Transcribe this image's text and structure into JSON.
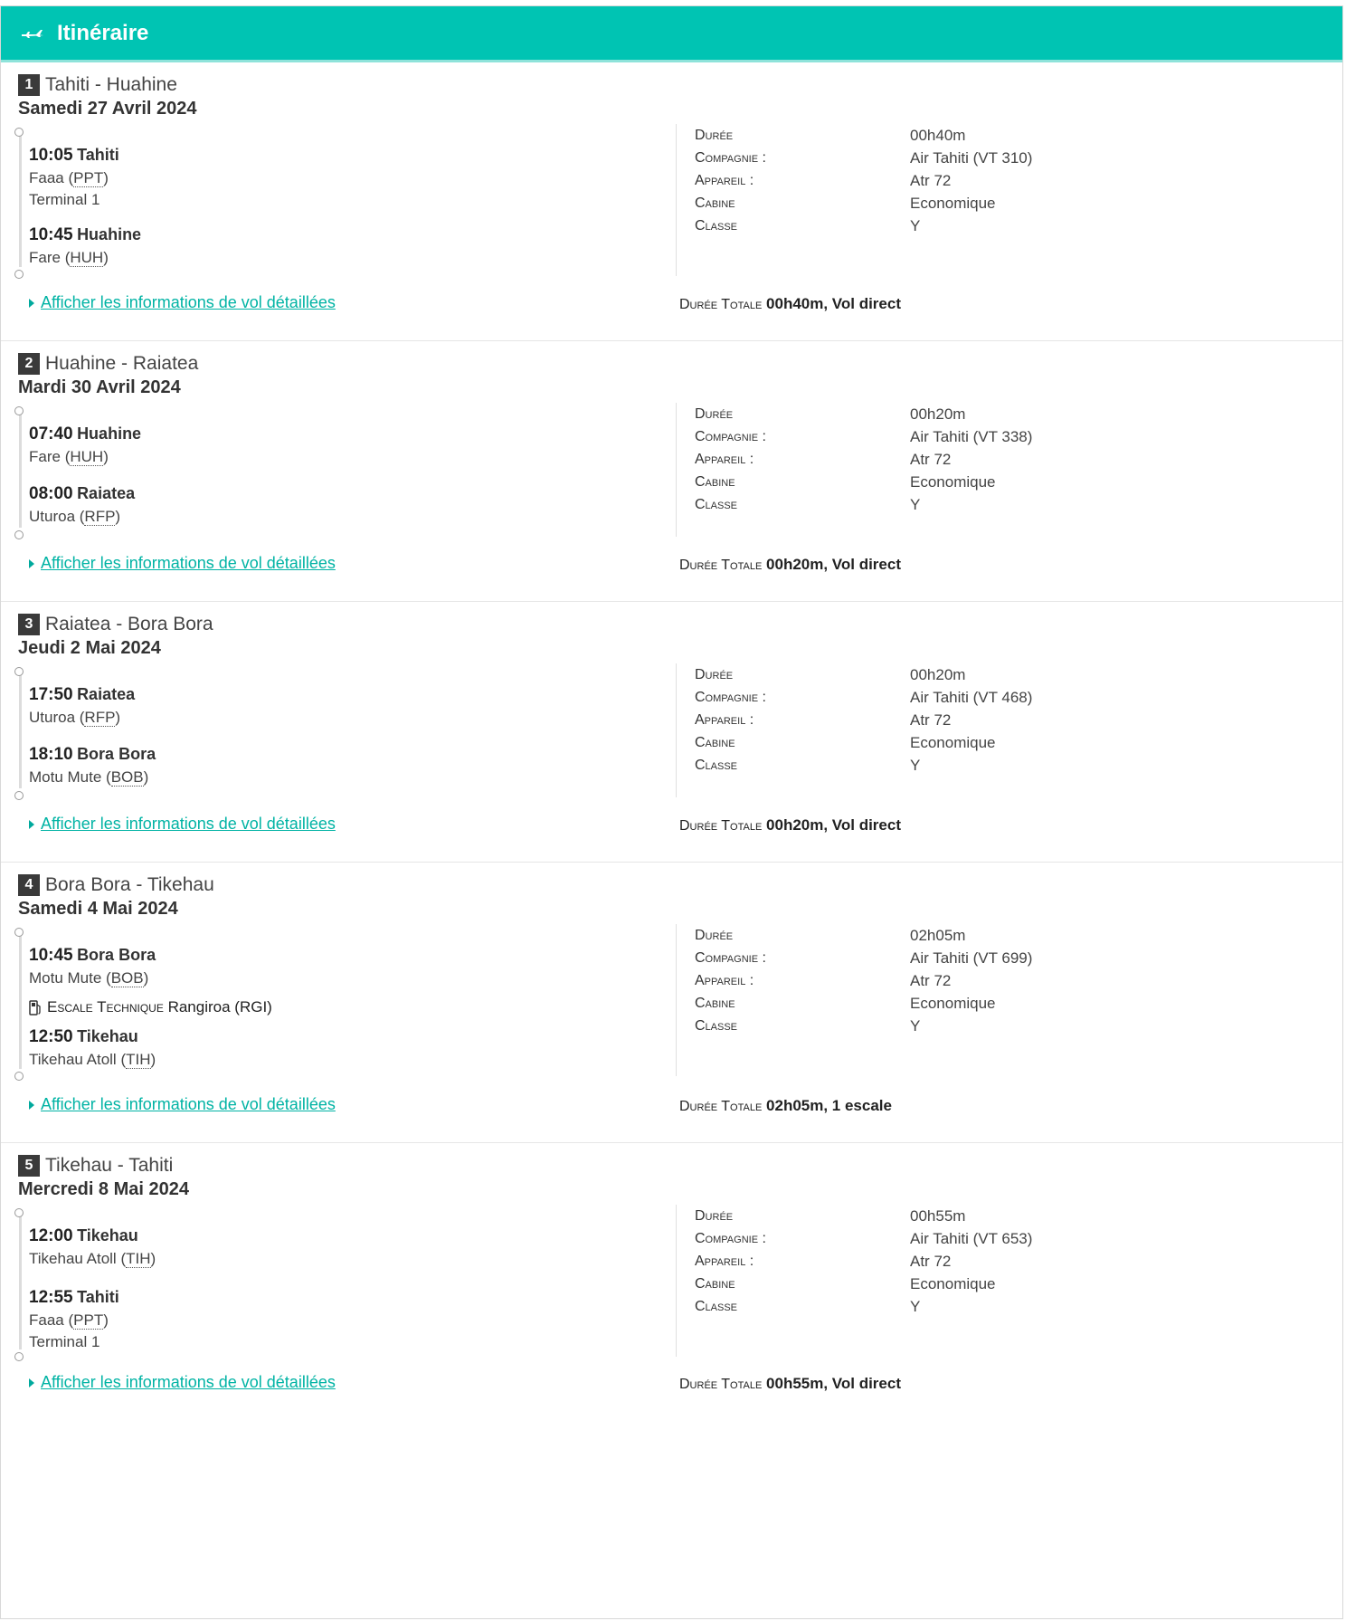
{
  "header": {
    "title": "Itinéraire"
  },
  "labels": {
    "duree": "Durée",
    "compagnie": "Compagnie :",
    "appareil": "Appareil :",
    "cabine": "Cabine",
    "classe": "Classe",
    "total": "Durée Totale",
    "details_link": "Afficher les informations de vol détaillées"
  },
  "segments": [
    {
      "num": "1",
      "route": "Tahiti - Huahine",
      "date": "Samedi 27 Avril 2024",
      "dep": {
        "time": "10:05",
        "city": "Tahiti",
        "airport": "Faaa",
        "code": "PPT",
        "terminal": "Terminal 1"
      },
      "arr": {
        "time": "10:45",
        "city": "Huahine",
        "airport": "Fare",
        "code": "HUH"
      },
      "duree": "00h40m",
      "compagnie": "Air Tahiti (VT 310)",
      "appareil": "Atr 72",
      "cabine": "Economique",
      "classe": "Y",
      "total": "00h40m, Vol direct"
    },
    {
      "num": "2",
      "route": "Huahine - Raiatea",
      "date": "Mardi 30 Avril 2024",
      "dep": {
        "time": "07:40",
        "city": "Huahine",
        "airport": "Fare",
        "code": "HUH"
      },
      "arr": {
        "time": "08:00",
        "city": "Raiatea",
        "airport": "Uturoa",
        "code": "RFP"
      },
      "duree": "00h20m",
      "compagnie": "Air Tahiti (VT 338)",
      "appareil": "Atr 72",
      "cabine": "Economique",
      "classe": "Y",
      "total": "00h20m, Vol direct"
    },
    {
      "num": "3",
      "route": "Raiatea - Bora Bora",
      "date": "Jeudi 2 Mai 2024",
      "dep": {
        "time": "17:50",
        "city": "Raiatea",
        "airport": "Uturoa",
        "code": "RFP"
      },
      "arr": {
        "time": "18:10",
        "city": "Bora Bora",
        "airport": "Motu Mute",
        "code": "BOB"
      },
      "duree": "00h20m",
      "compagnie": "Air Tahiti (VT 468)",
      "appareil": "Atr 72",
      "cabine": "Economique",
      "classe": "Y",
      "total": "00h20m, Vol direct"
    },
    {
      "num": "4",
      "route": "Bora Bora - Tikehau",
      "date": "Samedi 4 Mai 2024",
      "dep": {
        "time": "10:45",
        "city": "Bora Bora",
        "airport": "Motu Mute",
        "code": "BOB"
      },
      "escale": {
        "label": "Escale Technique",
        "place": "Rangiroa (RGI)"
      },
      "arr": {
        "time": "12:50",
        "city": "Tikehau",
        "airport": "Tikehau Atoll",
        "code": "TIH"
      },
      "duree": "02h05m",
      "compagnie": "Air Tahiti (VT 699)",
      "appareil": "Atr 72",
      "cabine": "Economique",
      "classe": "Y",
      "total": "02h05m, 1 escale"
    },
    {
      "num": "5",
      "route": "Tikehau - Tahiti",
      "date": "Mercredi 8 Mai 2024",
      "dep": {
        "time": "12:00",
        "city": "Tikehau",
        "airport": "Tikehau Atoll",
        "code": "TIH"
      },
      "arr": {
        "time": "12:55",
        "city": "Tahiti",
        "airport": "Faaa",
        "code": "PPT",
        "terminal": "Terminal 1"
      },
      "duree": "00h55m",
      "compagnie": "Air Tahiti (VT 653)",
      "appareil": "Atr 72",
      "cabine": "Economique",
      "classe": "Y",
      "total": "00h55m, Vol direct"
    }
  ]
}
